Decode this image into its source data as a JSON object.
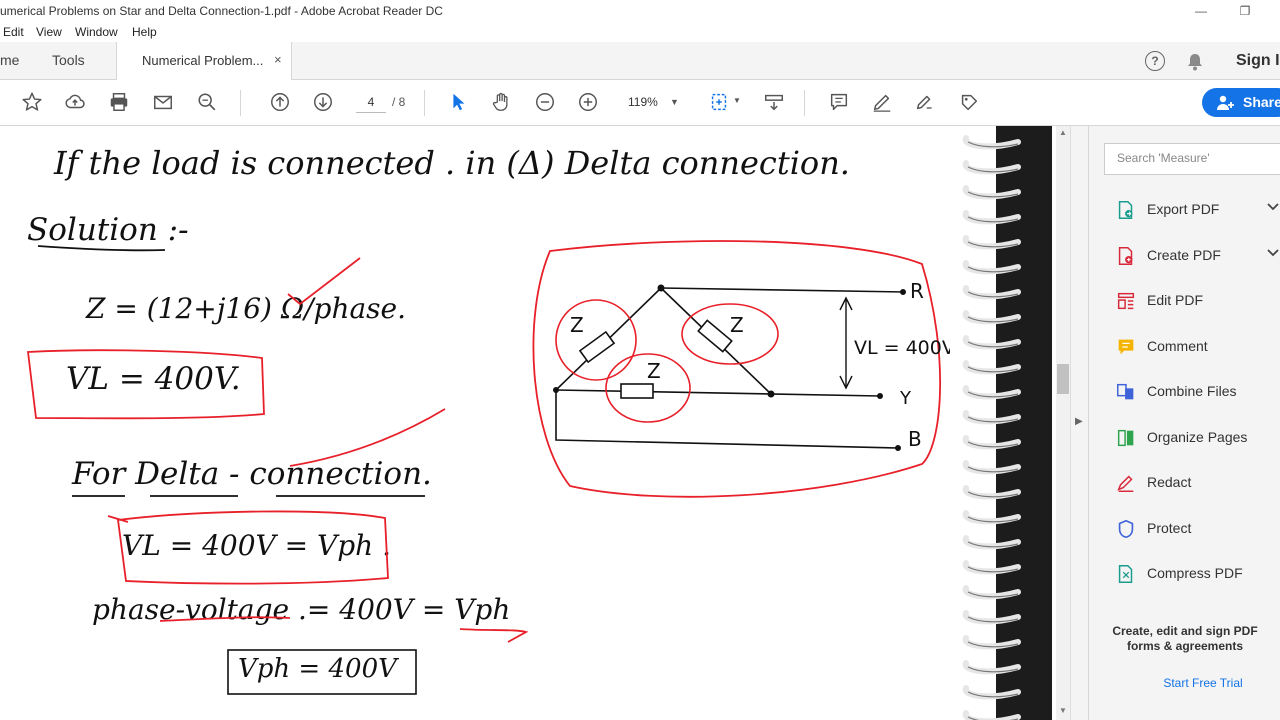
{
  "window": {
    "title": "umerical Problems on Star and Delta Connection-1.pdf - Adobe Acrobat Reader DC",
    "controls": {
      "minimize": "—",
      "restore": "❐"
    }
  },
  "menu": [
    "Edit",
    "View",
    "Window",
    "Help"
  ],
  "tabs": {
    "home": "me",
    "tools": "Tools",
    "document": "Numerical Problem...",
    "close": "×"
  },
  "header_right": {
    "help_glyph": "?",
    "sign_in": "Sign I"
  },
  "toolbar": {
    "current_page": "4",
    "page_total": "/ 8",
    "zoom": "119%",
    "share_label": "Share"
  },
  "colors": {
    "accent": "#1473e6",
    "annotation_red": "#e8202a"
  },
  "document": {
    "heading": "If the load is connected . in (Δ) Delta connection.",
    "solution_label": "Solution :-",
    "impedance": "Z = (12+j16) Ω/phase.",
    "line_voltage": "VL = 400V.",
    "delta_heading": "For Delta - connection.",
    "delta_relation": "VL = 400V = Vph .",
    "phase_voltage": "phase-voltage .= 400V = Vph",
    "vph_result": "Vph = 400V",
    "circuit": {
      "z_label": "Z",
      "terminal_r": "R",
      "terminal_y": "Y",
      "terminal_b": "B",
      "vl_label": "VL = 400V"
    }
  },
  "right_panel": {
    "search_placeholder": "Search 'Measure'",
    "tools": [
      {
        "label": "Export PDF",
        "icon": "export-pdf-icon",
        "color": "#1a9c8f",
        "expandable": true
      },
      {
        "label": "Create PDF",
        "icon": "create-pdf-icon",
        "color": "#d8293a",
        "expandable": true
      },
      {
        "label": "Edit PDF",
        "icon": "edit-pdf-icon",
        "color": "#d8293a",
        "expandable": false
      },
      {
        "label": "Comment",
        "icon": "comment-icon",
        "color": "#f5b400",
        "expandable": false
      },
      {
        "label": "Combine Files",
        "icon": "combine-files-icon",
        "color": "#3e62d8",
        "expandable": false
      },
      {
        "label": "Organize Pages",
        "icon": "organize-pages-icon",
        "color": "#2ea44f",
        "expandable": false
      },
      {
        "label": "Redact",
        "icon": "redact-icon",
        "color": "#d8293a",
        "expandable": false
      },
      {
        "label": "Protect",
        "icon": "protect-icon",
        "color": "#3e62d8",
        "expandable": false
      },
      {
        "label": "Compress PDF",
        "icon": "compress-pdf-icon",
        "color": "#1a9c8f",
        "expandable": false
      }
    ],
    "promo_line1": "Create, edit and sign PDF",
    "promo_line2": "forms & agreements",
    "trial_link": "Start Free Trial"
  }
}
